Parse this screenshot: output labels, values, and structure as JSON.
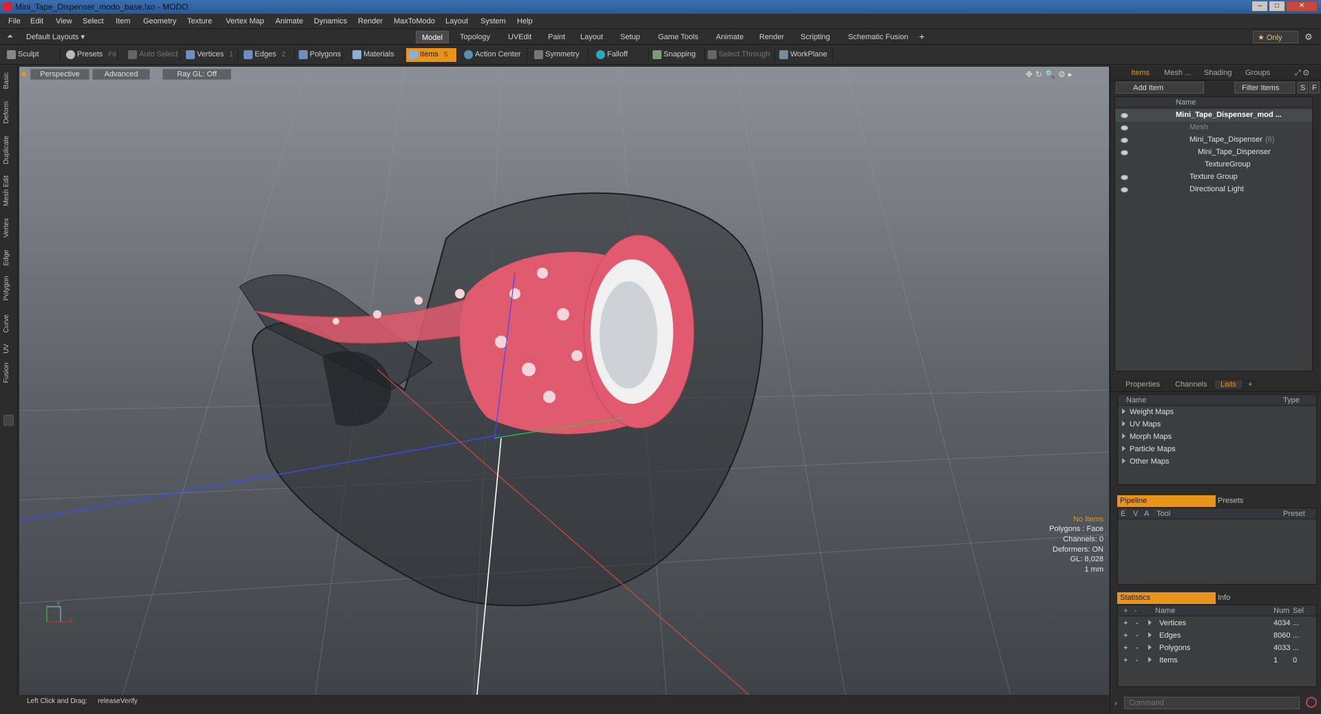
{
  "window": {
    "title": "Mini_Tape_Dispenser_modo_base.lxo - MODO"
  },
  "menu": [
    "File",
    "Edit",
    "View",
    "Select",
    "Item",
    "Geometry",
    "Texture",
    "Vertex Map",
    "Animate",
    "Dynamics",
    "Render",
    "MaxToModo",
    "Layout",
    "System",
    "Help"
  ],
  "layout": {
    "preset": "Default Layouts ▾",
    "tabs": [
      "Model",
      "Topology",
      "UVEdit",
      "Paint",
      "Layout",
      "Setup",
      "Game Tools",
      "Animate",
      "Render",
      "Scripting",
      "Schematic Fusion"
    ],
    "active_tab": "Model",
    "add": "+",
    "only": "★ Only"
  },
  "toolbar": {
    "sculpt": "Sculpt",
    "presets": "Presets",
    "presets_key": "F6",
    "auto_select": "Auto Select",
    "vertices": "Vertices",
    "vertices_count": "1",
    "edges": "Edges",
    "edges_count": "2",
    "polygons": "Polygons",
    "materials": "Materials",
    "items": "Items",
    "items_count": "5",
    "action_center": "Action Center",
    "symmetry": "Symmetry",
    "falloff": "Falloff",
    "snapping": "Snapping",
    "select_through": "Select Through",
    "workplane": "WorkPlane"
  },
  "left_tabs": [
    "Basic",
    "Deform",
    "Duplicate",
    "Mesh Edit",
    "Vertex",
    "Edge",
    "Polygon",
    "Curve",
    "UV",
    "Fusion"
  ],
  "viewport": {
    "view": "Perspective",
    "shading": "Advanced",
    "raygl": "Ray GL: Off",
    "info": {
      "selection": "No Items",
      "polygons": "Polygons : Face",
      "channels": "Channels: 0",
      "deformers": "Deformers: ON",
      "gl": "GL: 8,028",
      "unit": "1 mm"
    },
    "axis": {
      "x": "X",
      "y": "Y"
    }
  },
  "status": {
    "hint": "Left Click and Drag:",
    "value": "releaseVerify"
  },
  "items_panel": {
    "tabs": [
      "Items",
      "Mesh ...",
      "Shading",
      "Groups"
    ],
    "add_item": "Add Item",
    "filter": "Filter Items",
    "s": "S",
    "f": "F",
    "col_name": "Name",
    "tree": [
      {
        "label": "Mini_Tape_Dispenser_mod ...",
        "indent": 0,
        "bold": true
      },
      {
        "label": "Mesh",
        "indent": 1,
        "dim": true
      },
      {
        "label": "Mini_Tape_Dispenser",
        "suffix": "(6)",
        "indent": 1
      },
      {
        "label": "Mini_Tape_Dispenser",
        "indent": 2
      },
      {
        "label": "TextureGroup",
        "indent": 2
      },
      {
        "label": "Texture Group",
        "indent": 1
      },
      {
        "label": "Directional Light",
        "indent": 1
      }
    ]
  },
  "lists_panel": {
    "tabs": [
      "Properties",
      "Channels",
      "Lists",
      "+"
    ],
    "col_name": "Name",
    "col_type": "Type",
    "rows": [
      "Weight Maps",
      "UV Maps",
      "Morph Maps",
      "Particle Maps",
      "Other Maps"
    ]
  },
  "pipeline_panel": {
    "tabs": [
      "Pipeline",
      "Presets"
    ],
    "cols": [
      "E",
      "V",
      "A",
      "Tool",
      "Preset"
    ]
  },
  "stats_panel": {
    "tabs": [
      "Statistics",
      "Info"
    ],
    "cols": [
      "+",
      "-",
      "Name",
      "Num",
      "Sel"
    ],
    "rows": [
      {
        "name": "Vertices",
        "num": "4034",
        "sel": "..."
      },
      {
        "name": "Edges",
        "num": "8060",
        "sel": "..."
      },
      {
        "name": "Polygons",
        "num": "4033",
        "sel": "..."
      },
      {
        "name": "Items",
        "num": "1",
        "sel": "0"
      }
    ]
  },
  "command": {
    "placeholder": "Command"
  },
  "colors": {
    "accent": "#e8941a",
    "tape_pink": "#e05a6e",
    "dispenser": "#2a2c2e"
  }
}
